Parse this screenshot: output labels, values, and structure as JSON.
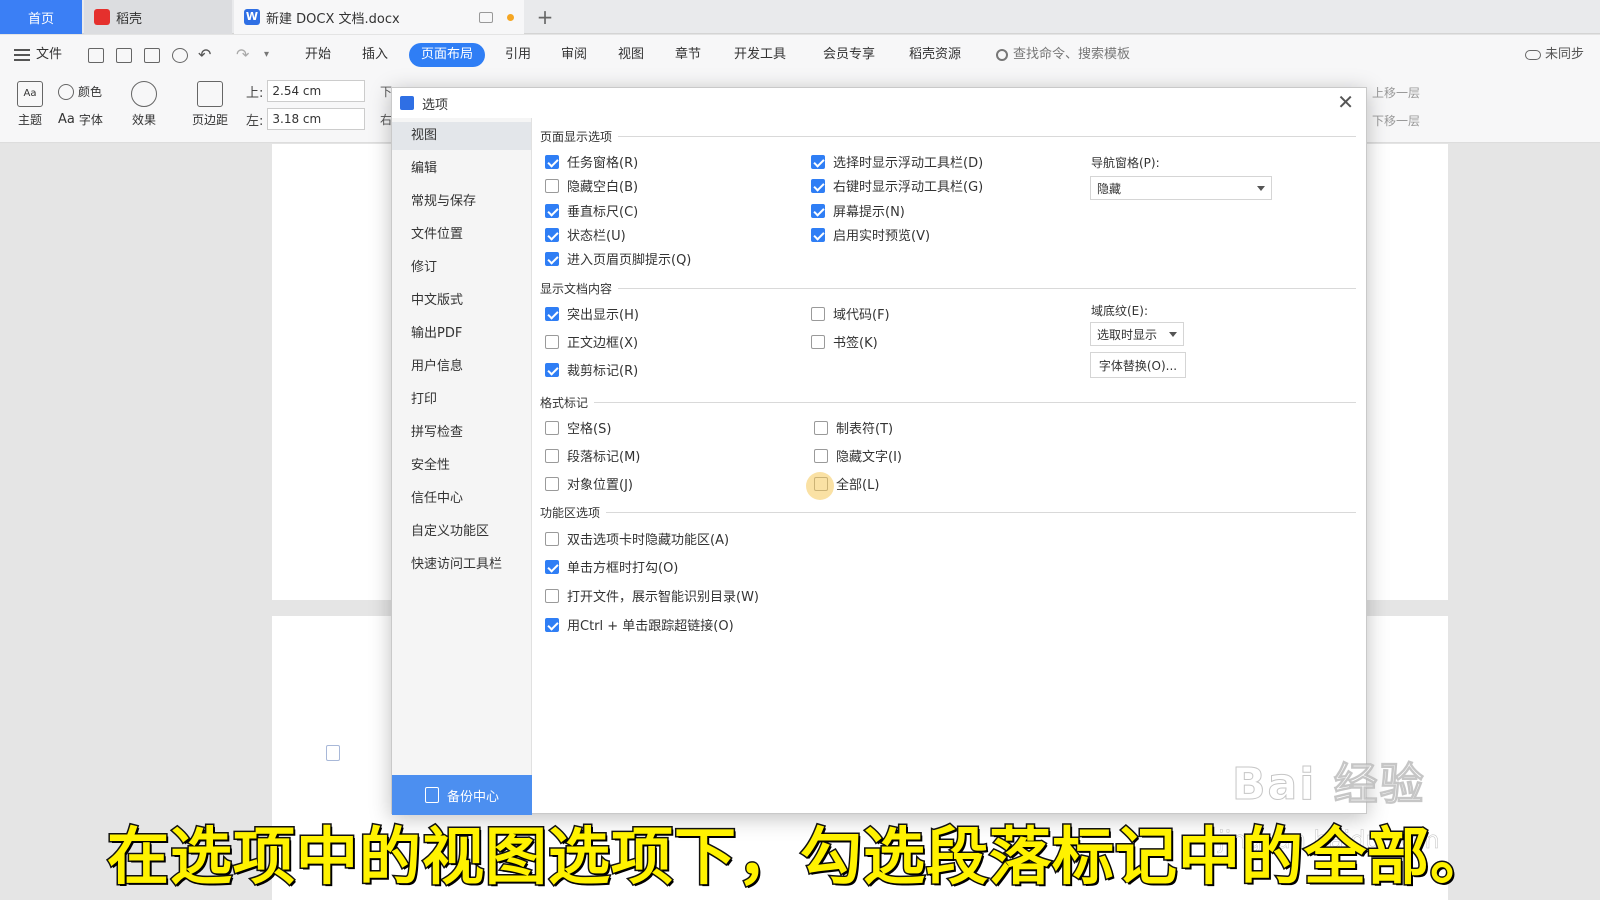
{
  "tabs": {
    "home": "首页",
    "daoke": "稻壳",
    "doc": "新建 DOCX 文档.docx"
  },
  "menu": {
    "file": "文件",
    "items": [
      "开始",
      "插入",
      "页面布局",
      "引用",
      "审阅",
      "视图",
      "章节",
      "开发工具",
      "会员专享",
      "稻壳资源"
    ],
    "active": "页面布局",
    "search_placeholder": "查找命令、搜索模板",
    "sync": "未同步"
  },
  "ribbon": {
    "theme": "主题",
    "color": "颜色",
    "font": "字体",
    "effect": "效果",
    "margins": "页边距",
    "top_label": "上:",
    "top_value": "2.54 cm",
    "left_label": "左:",
    "left_value": "3.18 cm",
    "bottom_label": "下",
    "right_label": "右",
    "move_up": "上移一层",
    "move_down": "下移一层"
  },
  "dialog": {
    "title": "选项",
    "nav": [
      "视图",
      "编辑",
      "常规与保存",
      "文件位置",
      "修订",
      "中文版式",
      "输出PDF",
      "用户信息",
      "打印",
      "拼写检查",
      "安全性",
      "信任中心",
      "自定义功能区",
      "快速访问工具栏"
    ],
    "nav_active": "视图",
    "backup": "备份中心",
    "sections": {
      "page_display": "页面显示选项",
      "doc_content": "显示文档内容",
      "format_marks": "格式标记",
      "ribbon_options": "功能区选项"
    },
    "page_display": {
      "col1": [
        {
          "label": "任务窗格(R)",
          "checked": true
        },
        {
          "label": "隐藏空白(B)",
          "checked": false
        },
        {
          "label": "垂直标尺(C)",
          "checked": true
        },
        {
          "label": "状态栏(U)",
          "checked": true
        },
        {
          "label": "进入页眉页脚提示(Q)",
          "checked": true
        }
      ],
      "col2": [
        {
          "label": "选择时显示浮动工具栏(D)",
          "checked": true
        },
        {
          "label": "右键时显示浮动工具栏(G)",
          "checked": true
        },
        {
          "label": "屏幕提示(N)",
          "checked": true
        },
        {
          "label": "启用实时预览(V)",
          "checked": true
        }
      ],
      "nav_pane_label": "导航窗格(P):",
      "nav_pane_value": "隐藏"
    },
    "doc_content": {
      "col1": [
        {
          "label": "突出显示(H)",
          "checked": true
        },
        {
          "label": "正文边框(X)",
          "checked": false
        },
        {
          "label": "裁剪标记(R)",
          "checked": true
        }
      ],
      "col2": [
        {
          "label": "域代码(F)",
          "checked": false
        },
        {
          "label": "书签(K)",
          "checked": false
        }
      ],
      "field_shading_label": "域底纹(E):",
      "field_shading_value": "选取时显示",
      "font_sub_button": "字体替换(O)..."
    },
    "format_marks": {
      "col1": [
        {
          "label": "空格(S)",
          "checked": false
        },
        {
          "label": "段落标记(M)",
          "checked": false
        },
        {
          "label": "对象位置(J)",
          "checked": false
        }
      ],
      "col2": [
        {
          "label": "制表符(T)",
          "checked": false
        },
        {
          "label": "隐藏文字(I)",
          "checked": false
        },
        {
          "label": "全部(L)",
          "checked": false
        }
      ]
    },
    "ribbon_options": [
      {
        "label": "双击选项卡时隐藏功能区(A)",
        "checked": false
      },
      {
        "label": "单击方框时打勾(O)",
        "checked": true
      },
      {
        "label": "打开文件，展示智能识别目录(W)",
        "checked": false
      },
      {
        "label": "用Ctrl + 单击跟踪超链接(O)",
        "checked": true
      }
    ]
  },
  "subtitle": "在选项中的视图选项下，勾选段落标记中的全部。",
  "watermark": "Bai 经验",
  "watermark_url": "jingyan.baidu.com"
}
